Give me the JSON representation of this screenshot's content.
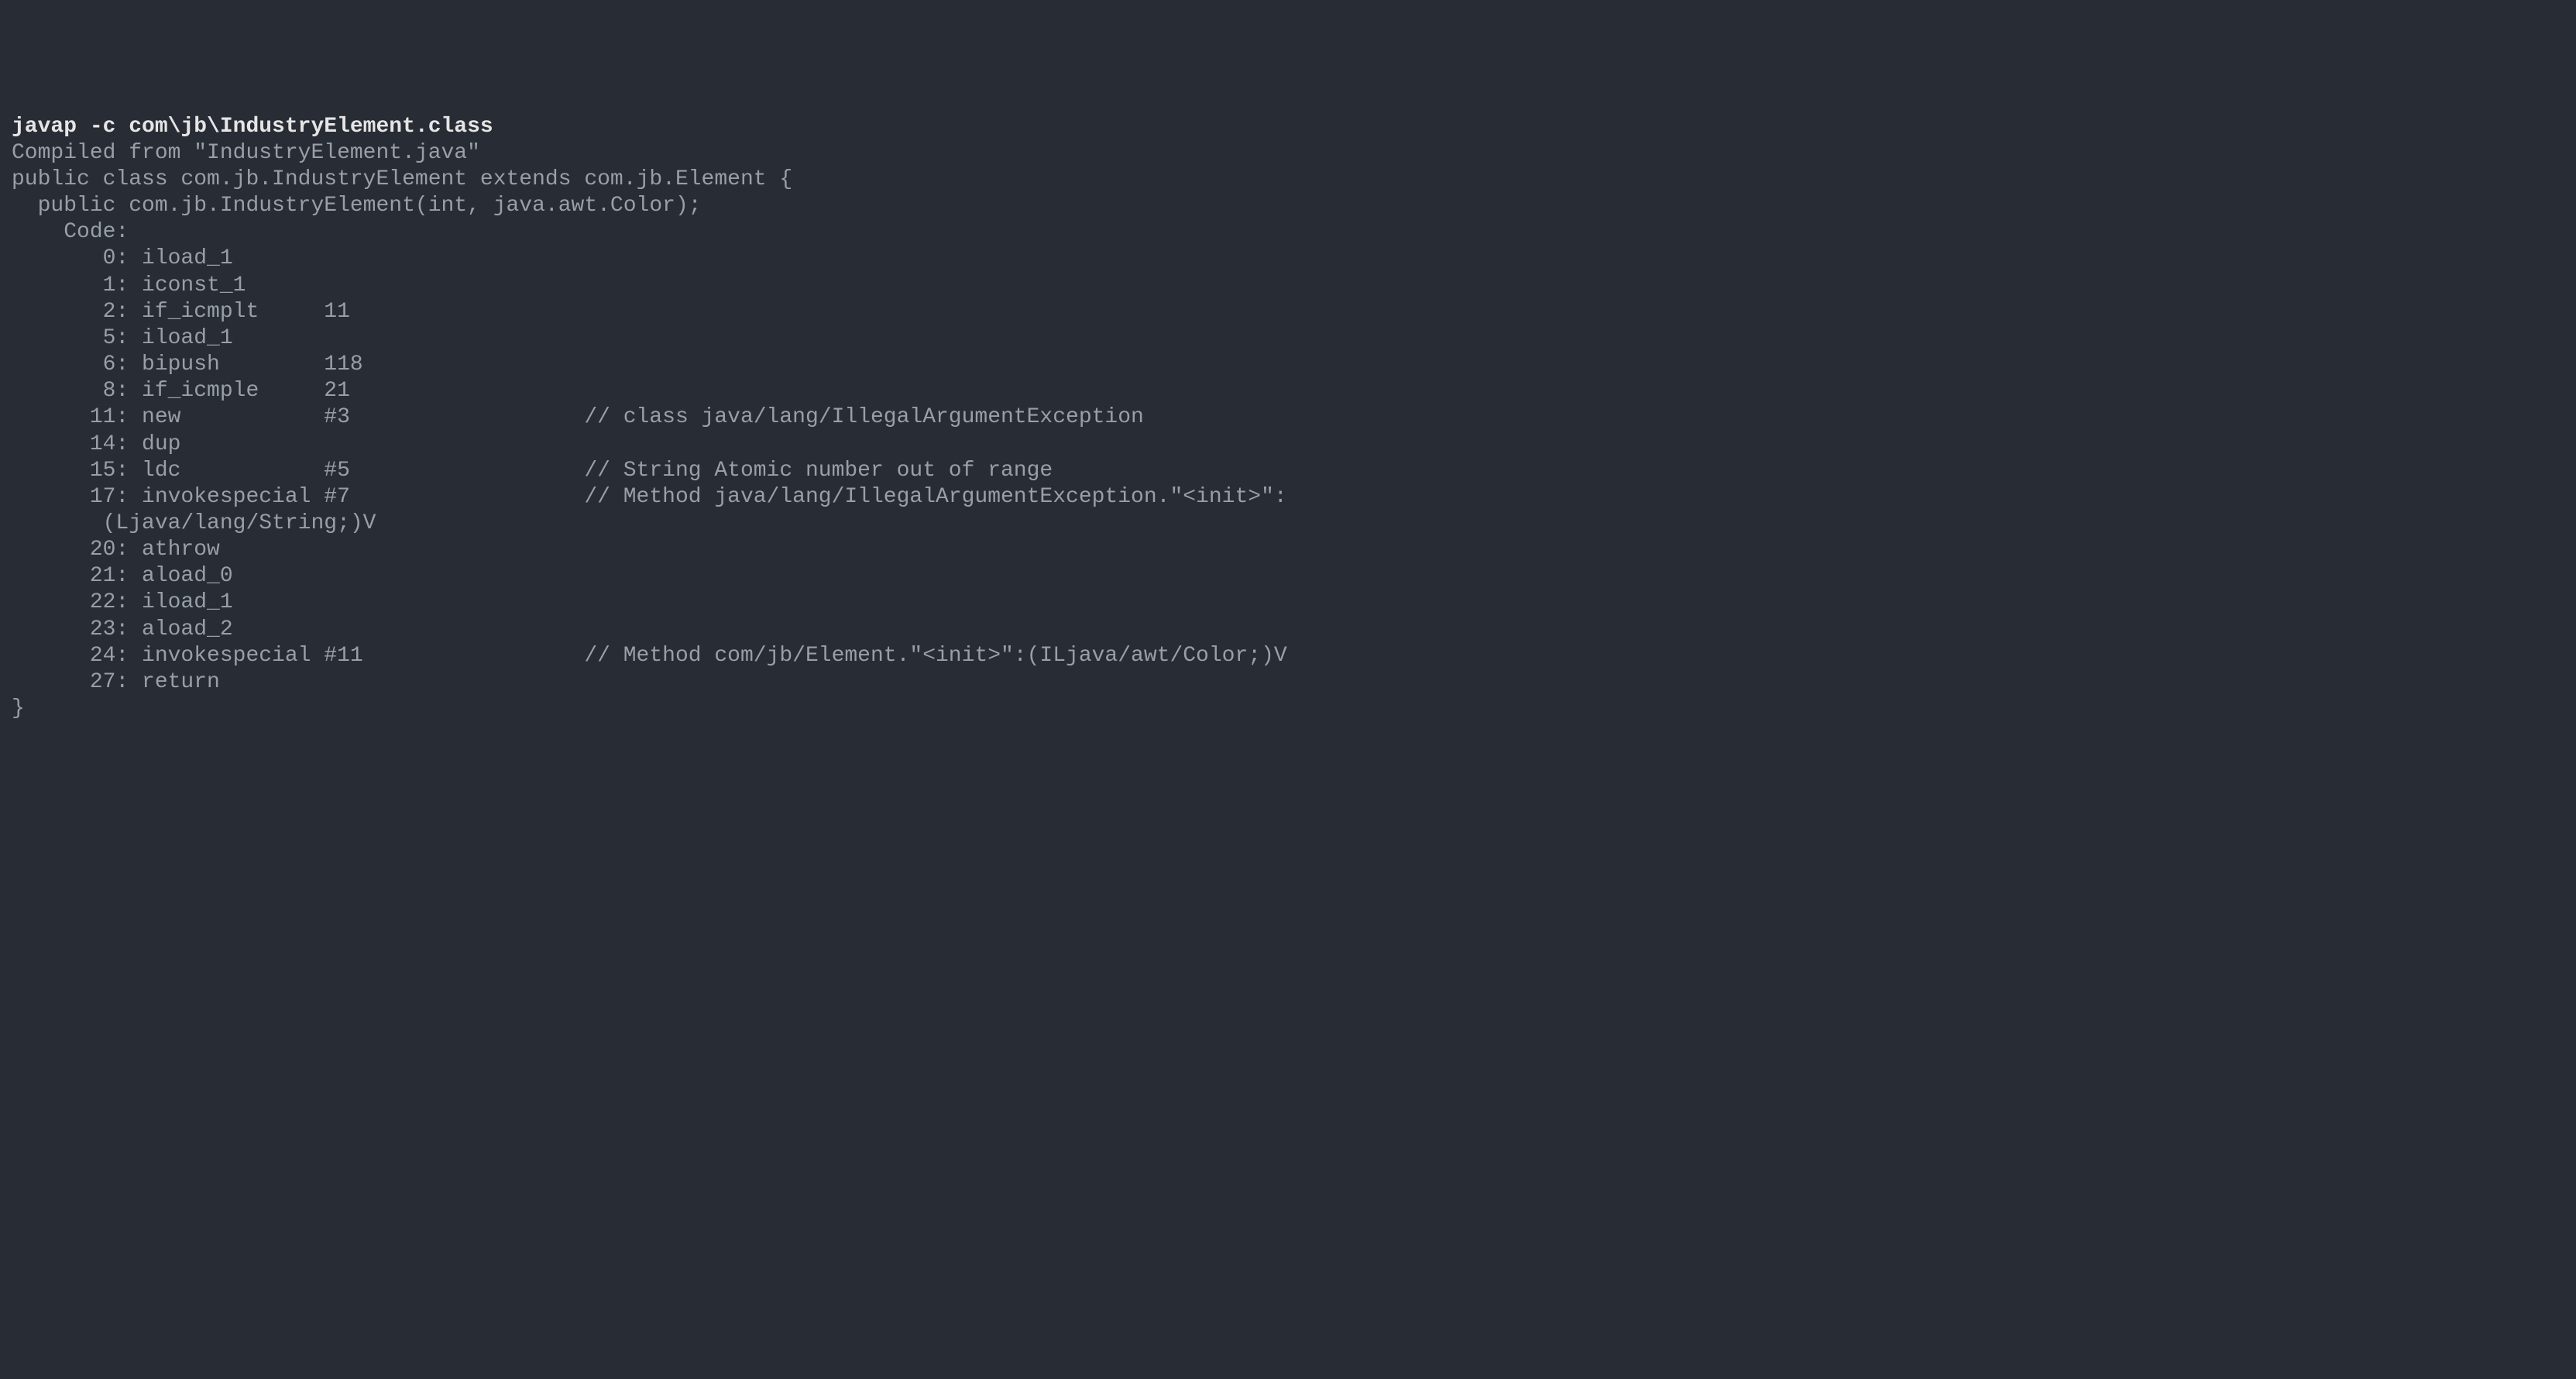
{
  "terminal": {
    "command": "javap -c com\\jb\\IndustryElement.class",
    "output": {
      "compiled_from": "Compiled from \"IndustryElement.java\"",
      "class_decl": "public class com.jb.IndustryElement extends com.jb.Element {",
      "constructor_sig": "  public com.jb.IndustryElement(int, java.awt.Color);",
      "code_label": "    Code:",
      "instructions": [
        "       0: iload_1",
        "       1: iconst_1",
        "       2: if_icmplt     11",
        "       5: iload_1",
        "       6: bipush        118",
        "       8: if_icmple     21",
        "      11: new           #3                  // class java/lang/IllegalArgumentException",
        "      14: dup",
        "      15: ldc           #5                  // String Atomic number out of range",
        "      17: invokespecial #7                  // Method java/lang/IllegalArgumentException.\"<init>\":",
        "       (Ljava/lang/String;)V",
        "      20: athrow",
        "      21: aload_0",
        "      22: iload_1",
        "      23: aload_2",
        "      24: invokespecial #11                 // Method com/jb/Element.\"<init>\":(ILjava/awt/Color;)V",
        "      27: return"
      ],
      "closing_brace": "}"
    }
  }
}
